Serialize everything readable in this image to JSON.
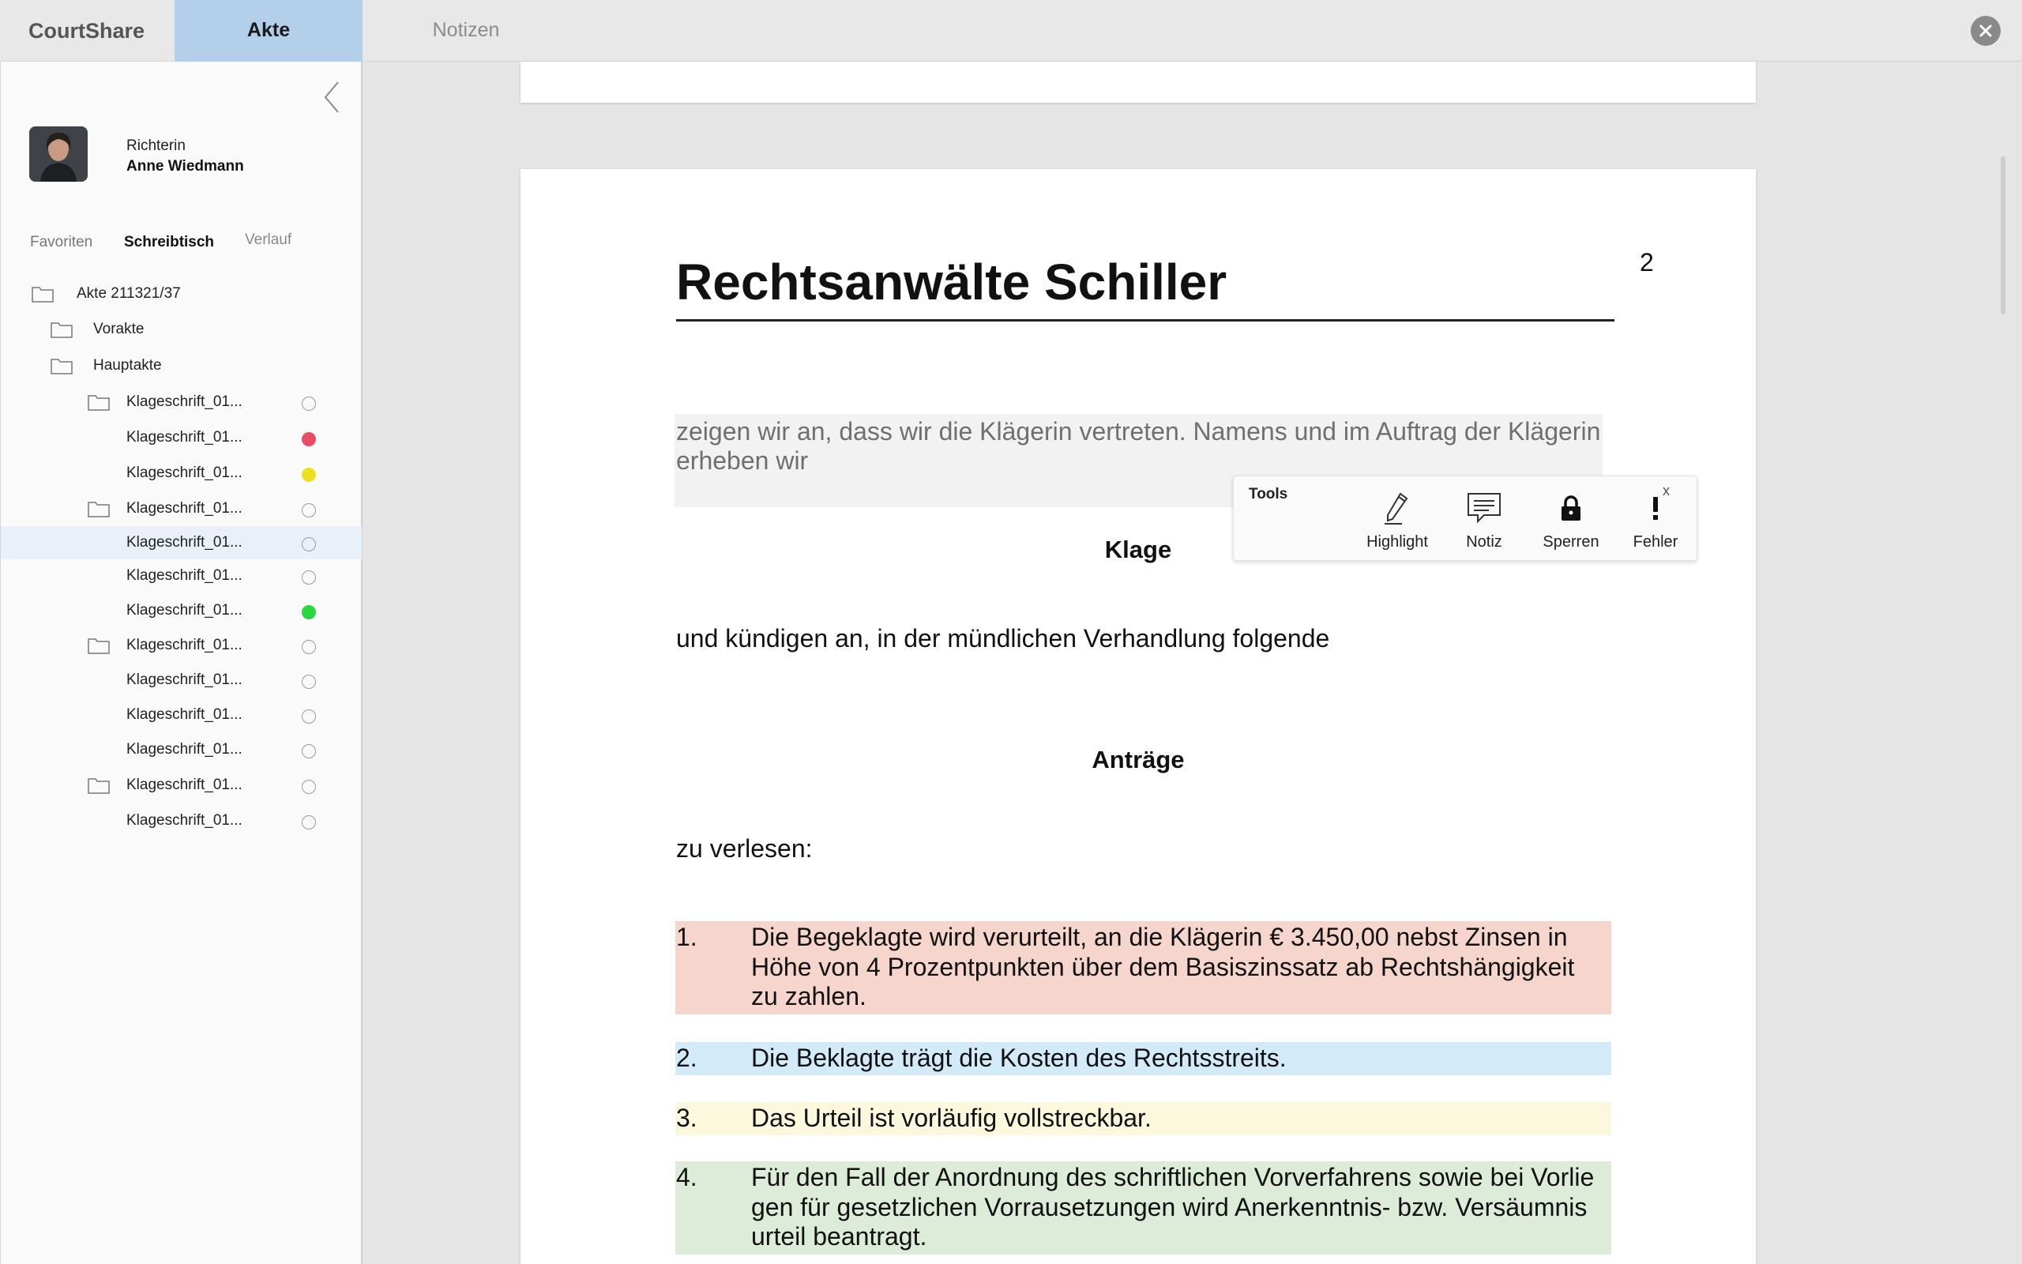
{
  "app": {
    "name": "CourtShare"
  },
  "tabs": [
    {
      "label": "Akte",
      "active": true
    },
    {
      "label": "Notizen",
      "active": false
    }
  ],
  "user": {
    "role": "Richterin",
    "name": "Anne Wiedmann"
  },
  "sidebar_tabs": [
    {
      "label": "Favoriten"
    },
    {
      "label": "Schreibtisch",
      "active": true
    },
    {
      "label": "Verlauf"
    }
  ],
  "tree": [
    {
      "label": "Akte 211321/37",
      "type": "folder"
    },
    {
      "label": "Vorakte",
      "type": "folder"
    },
    {
      "label": "Hauptakte",
      "type": "folder"
    },
    {
      "label": "Klageschrift_01...",
      "type": "folder",
      "status": "empty"
    },
    {
      "label": "Klageschrift_01...",
      "type": "file",
      "status": "red"
    },
    {
      "label": "Klageschrift_01...",
      "type": "file",
      "status": "yellow"
    },
    {
      "label": "Klageschrift_01...",
      "type": "folder",
      "status": "empty"
    },
    {
      "label": "Klageschrift_01...",
      "type": "file",
      "status": "empty",
      "selected": true
    },
    {
      "label": "Klageschrift_01...",
      "type": "file",
      "status": "empty"
    },
    {
      "label": "Klageschrift_01...",
      "type": "file",
      "status": "green"
    },
    {
      "label": "Klageschrift_01...",
      "type": "folder",
      "status": "empty"
    },
    {
      "label": "Klageschrift_01...",
      "type": "file",
      "status": "empty"
    },
    {
      "label": "Klageschrift_01...",
      "type": "file",
      "status": "empty"
    },
    {
      "label": "Klageschrift_01...",
      "type": "file",
      "status": "empty"
    },
    {
      "label": "Klageschrift_01...",
      "type": "folder",
      "status": "empty"
    },
    {
      "label": "Klageschrift_01...",
      "type": "file",
      "status": "empty"
    }
  ],
  "document": {
    "page_number": "2",
    "title": "Rechtsanwälte Schiller",
    "intro": "zeigen wir an, dass wir die Klägerin vertreten. Namens und im Auftrag der Klägerin erheben wir",
    "heading_klage": "Klage",
    "announce": "und kündigen an, in der mündlichen Verhandlung folgende",
    "heading_antraege": "Anträge",
    "read": "zu verlesen:",
    "requests": [
      {
        "num": "1.",
        "text": "Die Begeklagte wird verurteilt, an die Klägerin € 3.450,00 nebst Zinsen in Höhe von 4 Prozentpunkten über dem Basiszinssatz ab Rechtshängigkeit zu zahlen.",
        "highlight": "#f6d6cc"
      },
      {
        "num": "2.",
        "text": "Die Beklagte trägt die Kosten des Rechtsstreits.",
        "highlight": "#d3ebf9"
      },
      {
        "num": "3.",
        "text": "Das Urteil ist vorläufig vollstreckbar.",
        "highlight": "#fcf8dd"
      },
      {
        "num": "4.",
        "text": "Für den Fall der Anordnung des schriftlichen Vorverfahrens sowie bei Vorlie gen  für gesetzlichen Vorrausetzungen wird Anerkenntnis- bzw. Versäumnis urteil beantragt.",
        "highlight": "#dcecd8"
      }
    ]
  },
  "tools": {
    "title": "Tools",
    "close": "x",
    "items": [
      {
        "label": "Highlight",
        "icon": "pen-icon"
      },
      {
        "label": "Notiz",
        "icon": "comment-icon"
      },
      {
        "label": "Sperren",
        "icon": "lock-icon"
      },
      {
        "label": "Fehler",
        "icon": "exclamation-icon"
      }
    ]
  }
}
